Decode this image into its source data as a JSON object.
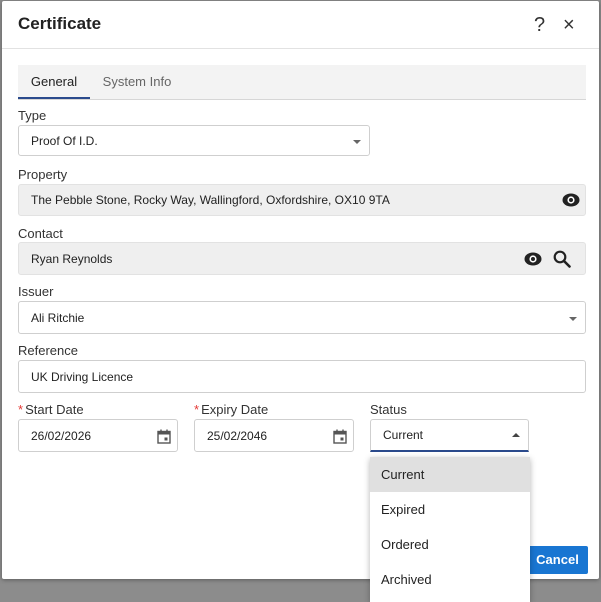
{
  "dialog": {
    "title": "Certificate",
    "help_glyph": "?",
    "close_glyph": "×"
  },
  "tabs": [
    {
      "label": "General",
      "active": true
    },
    {
      "label": "System Info",
      "active": false
    }
  ],
  "form": {
    "type": {
      "label": "Type",
      "value": "Proof Of I.D."
    },
    "property": {
      "label": "Property",
      "value": "The Pebble Stone, Rocky Way, Wallingford, Oxfordshire, OX10 9TA"
    },
    "contact": {
      "label": "Contact",
      "value": "Ryan Reynolds"
    },
    "issuer": {
      "label": "Issuer",
      "value": "Ali Ritchie"
    },
    "reference": {
      "label": "Reference",
      "value": "UK Driving Licence"
    },
    "start_date": {
      "label": "Start Date",
      "value": "26/02/2026",
      "required_mark": "*"
    },
    "expiry_date": {
      "label": "Expiry Date",
      "value": "25/02/2046",
      "required_mark": "*"
    },
    "status": {
      "label": "Status",
      "value": "Current"
    }
  },
  "status_options": [
    {
      "label": "Current",
      "selected": true
    },
    {
      "label": "Expired",
      "selected": false
    },
    {
      "label": "Ordered",
      "selected": false
    },
    {
      "label": "Archived",
      "selected": false
    }
  ],
  "footer": {
    "cancel_label": "Cancel"
  },
  "colors": {
    "accent": "#1976d2",
    "tab_underline": "#2a4a8c",
    "required": "#e53935"
  },
  "icons": [
    "help-icon",
    "close-icon",
    "eye-icon",
    "search-icon",
    "calendar-icon",
    "chevron-down-icon",
    "chevron-up-icon"
  ]
}
